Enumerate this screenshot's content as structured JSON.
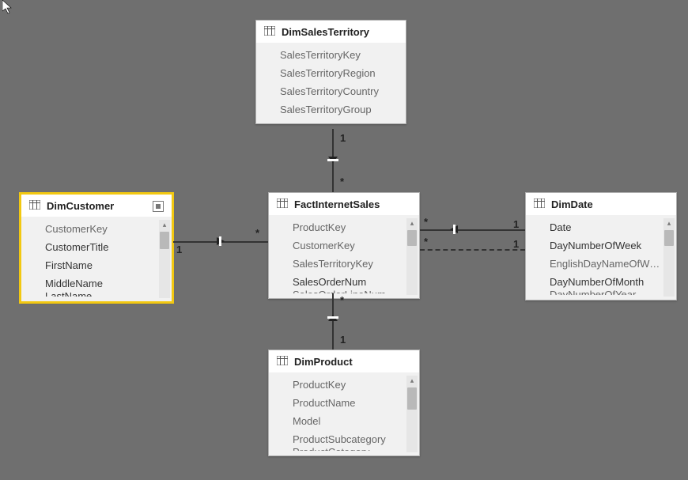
{
  "tables": {
    "dimSalesTerritory": {
      "title": "DimSalesTerritory",
      "fields": [
        "SalesTerritoryKey",
        "SalesTerritoryRegion",
        "SalesTerritoryCountry",
        "SalesTerritoryGroup"
      ]
    },
    "dimCustomer": {
      "title": "DimCustomer",
      "selected": true,
      "fields": [
        "CustomerKey",
        "CustomerTitle",
        "FirstName",
        "MiddleName",
        "LastName"
      ]
    },
    "factInternetSales": {
      "title": "FactInternetSales",
      "fields": [
        "ProductKey",
        "CustomerKey",
        "SalesTerritoryKey",
        "SalesOrderNum",
        "SalesOrderLineNum"
      ]
    },
    "dimDate": {
      "title": "DimDate",
      "fields": [
        "Date",
        "DayNumberOfWeek",
        "EnglishDayNameOfWeek",
        "DayNumberOfMonth",
        "DayNumberOfYear"
      ]
    },
    "dimProduct": {
      "title": "DimProduct",
      "fields": [
        "ProductKey",
        "ProductName",
        "Model",
        "ProductSubcategory",
        "ProductCategory"
      ]
    }
  },
  "rels": {
    "salesTerritory": {
      "top": "1",
      "bottom": "*"
    },
    "customer": {
      "left": "1",
      "right": "*"
    },
    "date1": {
      "left": "*",
      "right": "1"
    },
    "date2": {
      "left": "*",
      "right": "1",
      "active": false
    },
    "product": {
      "top": "*",
      "bottom": "1"
    }
  }
}
